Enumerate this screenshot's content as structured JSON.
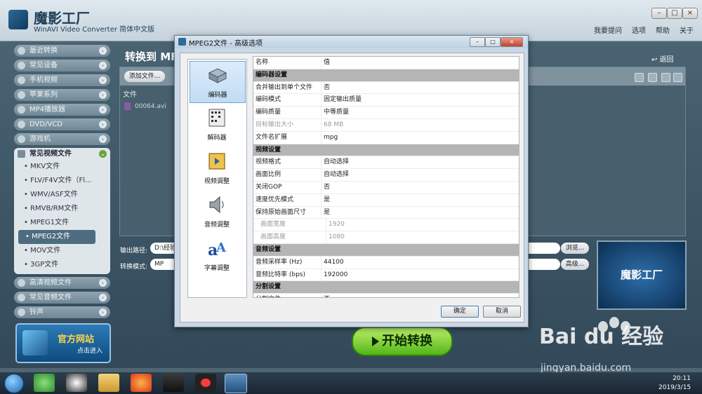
{
  "app": {
    "title": "魔影工厂",
    "subtitle": "WinAVI Video Converter 简体中文版",
    "menu": [
      "我要提问",
      "选项",
      "帮助",
      "关于"
    ]
  },
  "sidebar": {
    "cats_top": [
      "最近转换",
      "常见设备",
      "手机视频",
      "苹果系列",
      "MP4播放器",
      "DVD/VCD",
      "游戏机"
    ],
    "open_cat": "常见视频文件",
    "sub": [
      "• MKV文件",
      "• FLV/F4V文件（Fl...",
      "• WMV/ASF文件",
      "• RMVB/RM文件",
      "• MPEG1文件",
      "• MPEG2文件",
      "• MOV文件",
      "• 3GP文件"
    ],
    "cats_bottom": [
      "高清视频文件",
      "常见音频文件",
      "铃声"
    ],
    "banner_title": "官方网站",
    "banner_sub": "点击进入"
  },
  "main": {
    "title": "转换到 MF",
    "back": "返回",
    "add_file": "添加文件...",
    "file_col": "文件",
    "file_name": "00064.avi",
    "output_label": "输出路径:",
    "output_value": "D:\\经验",
    "mode_label": "转换模式:",
    "mode_value": "MP",
    "browse": "浏览...",
    "advanced": "高级...",
    "preview_text": "魔影工厂",
    "start": "开始转换"
  },
  "dialog": {
    "title": "MPEG2文件 - 高级选项",
    "nav": [
      "编码器",
      "解码器",
      "视频调整",
      "音频调整",
      "字幕调整"
    ],
    "grid_head": {
      "name": "名称",
      "value": "值"
    },
    "rows": [
      {
        "type": "sec",
        "name": "编码器设置",
        "value": ""
      },
      {
        "type": "row",
        "name": "合并输出到单个文件",
        "value": "否"
      },
      {
        "type": "row",
        "name": "编码模式",
        "value": "固定输出质量"
      },
      {
        "type": "row",
        "name": "编码质量",
        "value": "中等质量"
      },
      {
        "type": "dis",
        "name": "目标输出大小",
        "value": "68 MB"
      },
      {
        "type": "row",
        "name": "文件名扩展",
        "value": "mpg"
      },
      {
        "type": "sec",
        "name": "视频设置",
        "value": ""
      },
      {
        "type": "row",
        "name": "视频格式",
        "value": "自动选择"
      },
      {
        "type": "row",
        "name": "画面比例",
        "value": "自动选择"
      },
      {
        "type": "row",
        "name": "关闭GOP",
        "value": "否"
      },
      {
        "type": "row",
        "name": "速度优先模式",
        "value": "是"
      },
      {
        "type": "row",
        "name": "保持原始画面尺寸",
        "value": "是"
      },
      {
        "type": "dis-ind",
        "name": "画面宽度",
        "value": "1920"
      },
      {
        "type": "dis-ind",
        "name": "画面高度",
        "value": "1080"
      },
      {
        "type": "sec",
        "name": "音频设置",
        "value": ""
      },
      {
        "type": "row",
        "name": "音频采样率 (Hz)",
        "value": "44100"
      },
      {
        "type": "row",
        "name": "音频比特率 (bps)",
        "value": "192000"
      },
      {
        "type": "sec",
        "name": "分割设置",
        "value": ""
      },
      {
        "type": "row",
        "name": "分割文件",
        "value": "否"
      }
    ],
    "ok": "确定",
    "cancel": "取消"
  },
  "taskbar": {
    "time": "20:11",
    "date": "2019/3/15"
  },
  "watermark": {
    "text": "Bai  du 经验",
    "url": "jingyan.baidu.com"
  },
  "colors": {
    "accent": "#3c5564",
    "start_button": "#52b617",
    "section_row": "#b5b5b5"
  }
}
